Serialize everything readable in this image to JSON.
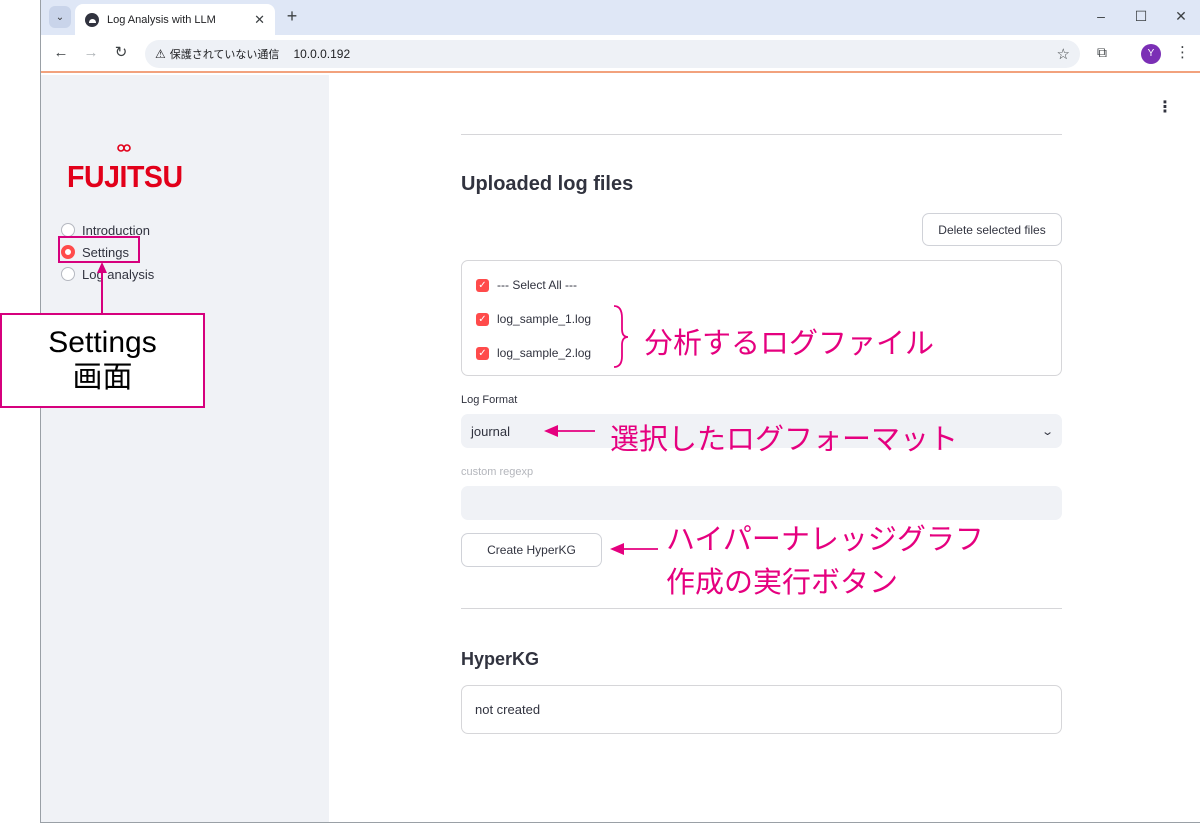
{
  "browser": {
    "tab_title": "Log Analysis with LLM",
    "security_label": "保護されていない通信",
    "url": "10.0.0.192",
    "avatar_initial": "Y"
  },
  "sidebar": {
    "logo_text": "FUJITSU",
    "nav_items": [
      {
        "label": "Introduction",
        "selected": false
      },
      {
        "label": "Settings",
        "selected": true
      },
      {
        "label": "Log analysis",
        "selected": false
      }
    ]
  },
  "main": {
    "uploaded_heading": "Uploaded log files",
    "delete_button": "Delete selected files",
    "files": [
      {
        "label": "--- Select All ---",
        "checked": true
      },
      {
        "label": "log_sample_1.log",
        "checked": true
      },
      {
        "label": "log_sample_2.log",
        "checked": true
      }
    ],
    "log_format_label": "Log Format",
    "log_format_value": "journal",
    "custom_regexp_label": "custom regexp",
    "custom_regexp_value": "",
    "create_button": "Create HyperKG",
    "hyperkg_heading": "HyperKG",
    "hyperkg_status": "not created"
  },
  "annotations": {
    "settings_callout_line1": "Settings",
    "settings_callout_line2": "画面",
    "log_files_note": "分析するログファイル",
    "log_format_note": "選択したログフォーマット",
    "create_note_line1": "ハイパーナレッジグラフ",
    "create_note_line2": "作成の実行ボタン",
    "accent_color": "#e5007f"
  }
}
